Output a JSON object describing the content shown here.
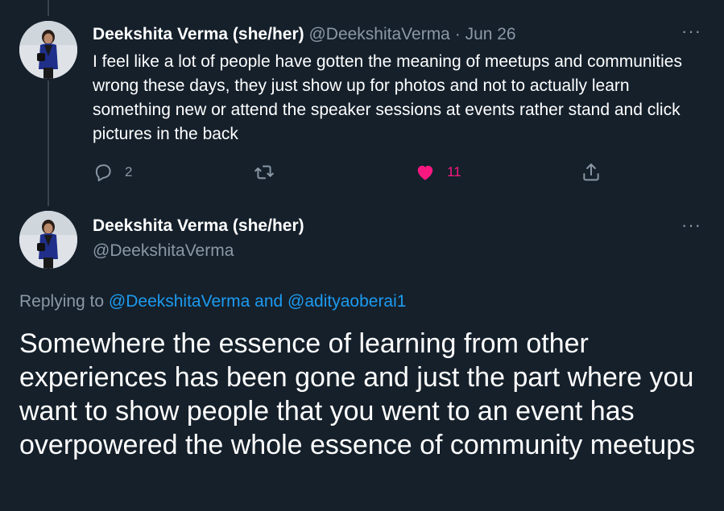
{
  "tweet1": {
    "author_name": "Deekshita Verma (she/her)",
    "handle": "@DeekshitaVerma",
    "separator": "·",
    "date": "Jun 26",
    "text": "I feel like a lot of people have gotten the meaning of meetups and communities wrong these days, they just show up for photos and not to actually learn something new or attend the speaker sessions at events rather stand and click pictures in the back",
    "more_label": "···",
    "reply_count": "2",
    "like_count": "11",
    "icons": [
      "reply-icon",
      "retweet-icon",
      "heart-icon",
      "share-icon"
    ]
  },
  "tweet2": {
    "author_name": "Deekshita Verma (she/her)",
    "handle": "@DeekshitaVerma",
    "more_label": "···",
    "replying_prefix": "Replying to",
    "replying_user1": "@DeekshitaVerma",
    "replying_and": "and",
    "replying_user2": "@adityaoberai1",
    "text": "Somewhere the essence of learning from other experiences has been gone and just the part where you want to show people that you went to an event has overpowered the whole essence of community meetups"
  },
  "colors": {
    "background": "#15202b",
    "muted": "#8b98a5",
    "link": "#1d9bf0",
    "like": "#f91880",
    "thread_line": "#38444d"
  }
}
